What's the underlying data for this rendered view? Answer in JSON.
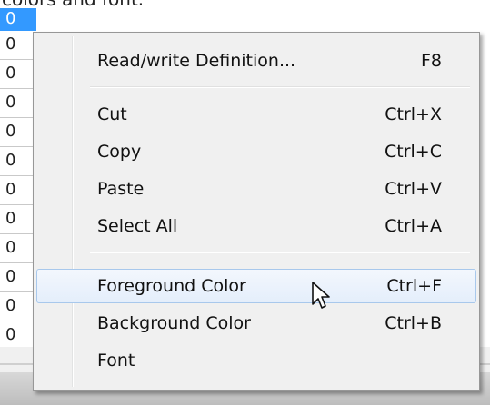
{
  "caption": "colors and font.",
  "grid": {
    "cells": [
      "0",
      "0",
      "0",
      "0",
      "0",
      "0",
      "0",
      "0",
      "0",
      "0",
      "0",
      "0"
    ]
  },
  "menu": {
    "items": [
      {
        "label": "Read/write Definition...",
        "shortcut": "F8"
      },
      {
        "label": "Cut",
        "shortcut": "Ctrl+X"
      },
      {
        "label": "Copy",
        "shortcut": "Ctrl+C"
      },
      {
        "label": "Paste",
        "shortcut": "Ctrl+V"
      },
      {
        "label": "Select All",
        "shortcut": "Ctrl+A"
      },
      {
        "label": "Foreground Color",
        "shortcut": "Ctrl+F"
      },
      {
        "label": "Background Color",
        "shortcut": "Ctrl+B"
      },
      {
        "label": "Font",
        "shortcut": ""
      }
    ],
    "hovered_item": "Foreground Color"
  },
  "colors": {
    "selection": "#3399ff",
    "menu_background": "#f0f0f0",
    "hover_border": "#a8c8ec"
  },
  "icons": {
    "cursor": "arrow-cursor-icon"
  }
}
